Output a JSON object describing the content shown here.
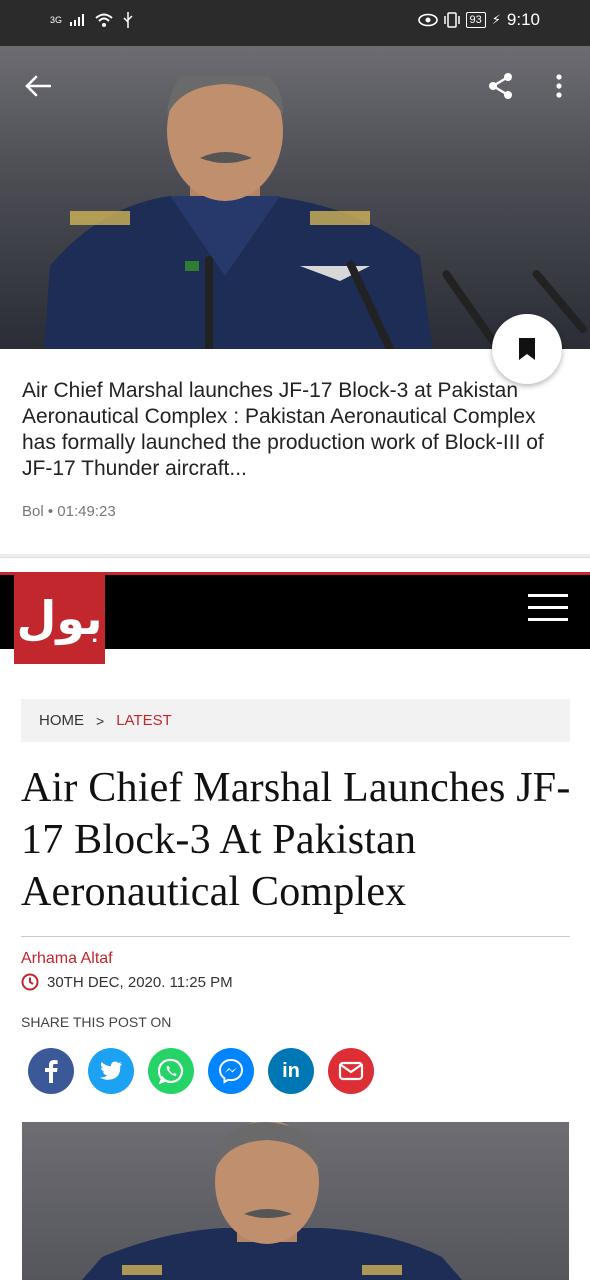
{
  "status_bar": {
    "network": "3G",
    "battery": "93",
    "time": "9:10"
  },
  "card": {
    "summary": "Air Chief Marshal launches JF-17 Block-3 at Pakistan Aeronautical Complex : Pakistan Aeronautical Complex has formally launched the production work of Block-III of JF-17 Thunder aircraft...",
    "source": "Bol",
    "time": "01:49:23"
  },
  "site": {
    "logo_text": "بول"
  },
  "breadcrumb": {
    "home": "HOME",
    "separator": ">",
    "current": "LATEST"
  },
  "article": {
    "title": "Air Chief Marshal Launches JF-17 Block-3 At Pakistan Aeronautical Complex",
    "author": "Arhama Altaf",
    "date": "30TH DEC, 2020. 11:25 PM",
    "share_label": "SHARE THIS POST ON"
  },
  "share_buttons": [
    {
      "name": "facebook",
      "color": "#3b5998",
      "glyph": "f"
    },
    {
      "name": "twitter",
      "color": "#1da1f2",
      "glyph": "t"
    },
    {
      "name": "whatsapp",
      "color": "#25d366",
      "glyph": "w"
    },
    {
      "name": "messenger",
      "color": "#0084ff",
      "glyph": "m"
    },
    {
      "name": "linkedin",
      "color": "#0077b5",
      "glyph": "in"
    },
    {
      "name": "email",
      "color": "#dd2e35",
      "glyph": "e"
    }
  ],
  "colors": {
    "accent": "#c1272d",
    "status_bar": "#2b2b2b"
  }
}
